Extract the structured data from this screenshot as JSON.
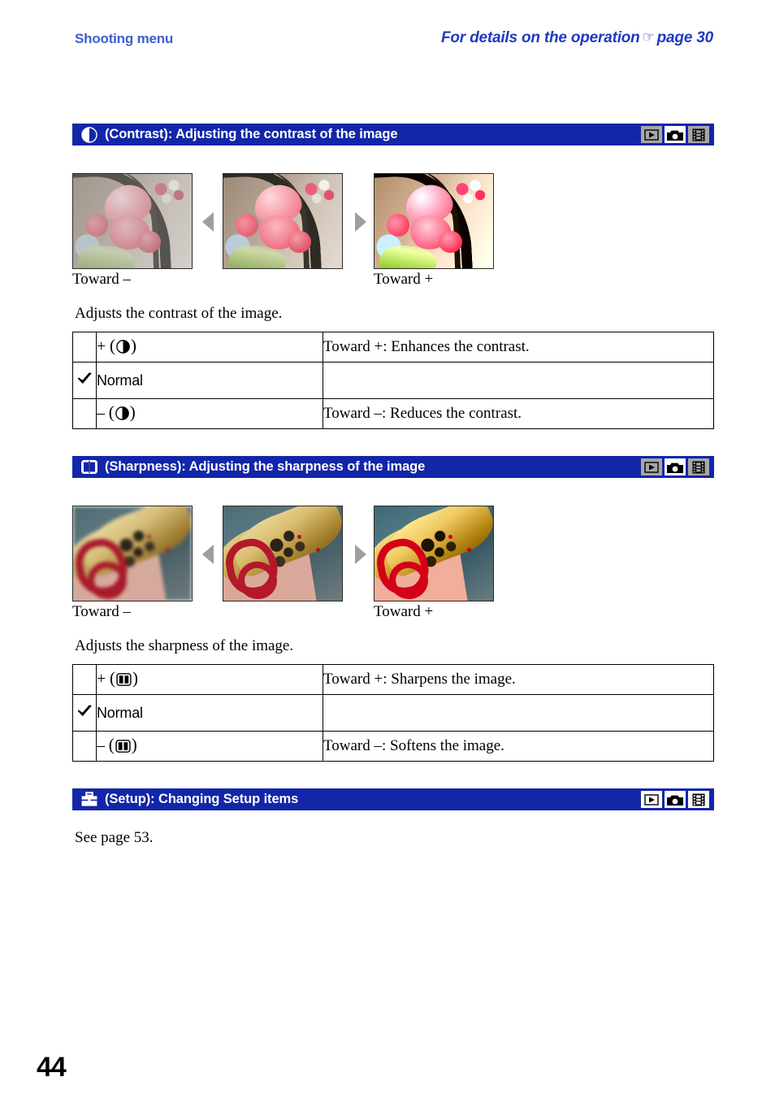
{
  "running_head": {
    "left": "Shooting menu",
    "right_pre": "For details on the operation",
    "right_glyph": "☞",
    "right_post": "page 30"
  },
  "page_number": "44",
  "sections": [
    {
      "id": "contrast",
      "icon_name": "contrast-icon",
      "title": "(Contrast): Adjusting the contrast of the image",
      "mode_icons": [
        {
          "name": "playback-mode-icon",
          "glyph": "▶",
          "active": false
        },
        {
          "name": "camera-mode-icon",
          "glyph": "camera",
          "active": true
        },
        {
          "name": "movie-mode-icon",
          "glyph": "film",
          "active": false
        }
      ],
      "thumbnails": {
        "subject": "flower",
        "left_caption": "Toward –",
        "right_caption": "Toward +",
        "left_arrow": "◀",
        "right_arrow": "▶"
      },
      "description": "Adjusts the contrast of the image.",
      "table": [
        {
          "checked": false,
          "sign": "+",
          "icon": "contrast-icon",
          "label_sans": false,
          "desc": "Toward +: Enhances the contrast."
        },
        {
          "checked": true,
          "sign": "",
          "icon": "",
          "label_text": "Normal",
          "label_sans": true,
          "desc": ""
        },
        {
          "checked": false,
          "sign": "–",
          "icon": "contrast-icon",
          "label_sans": false,
          "desc": "Toward –: Reduces the contrast."
        }
      ]
    },
    {
      "id": "sharpness",
      "icon_name": "sharpness-icon",
      "title": "(Sharpness): Adjusting the sharpness of the image",
      "mode_icons": [
        {
          "name": "playback-mode-icon",
          "glyph": "▶",
          "active": false
        },
        {
          "name": "camera-mode-icon",
          "glyph": "camera",
          "active": true
        },
        {
          "name": "movie-mode-icon",
          "glyph": "film",
          "active": false
        }
      ],
      "thumbnails": {
        "subject": "saxophone",
        "left_caption": "Toward –",
        "right_caption": "Toward +",
        "left_arrow": "◀",
        "right_arrow": "▶"
      },
      "description": "Adjusts the sharpness of the image.",
      "table": [
        {
          "checked": false,
          "sign": "+",
          "icon": "sharpness-icon",
          "label_sans": false,
          "desc": "Toward +: Sharpens the image."
        },
        {
          "checked": true,
          "sign": "",
          "icon": "",
          "label_text": "Normal",
          "label_sans": true,
          "desc": ""
        },
        {
          "checked": false,
          "sign": "–",
          "icon": "sharpness-icon",
          "label_sans": false,
          "desc": "Toward –: Softens the image."
        }
      ]
    },
    {
      "id": "setup",
      "icon_name": "toolbox-icon",
      "title": "(Setup): Changing Setup items",
      "mode_icons": [
        {
          "name": "playback-mode-icon",
          "glyph": "▶",
          "active": true
        },
        {
          "name": "camera-mode-icon",
          "glyph": "camera",
          "active": true
        },
        {
          "name": "movie-mode-icon",
          "glyph": "film",
          "active": true
        }
      ],
      "description": "See page 53."
    }
  ],
  "colors": {
    "header_bar_blue": "#1226a8",
    "running_head_blue": "#3c5fcd",
    "running_head_right_blue": "#1d3bc0",
    "mode_chip_inactive": "#a6a6a6",
    "arrow_gray": "#9e9e9e"
  }
}
